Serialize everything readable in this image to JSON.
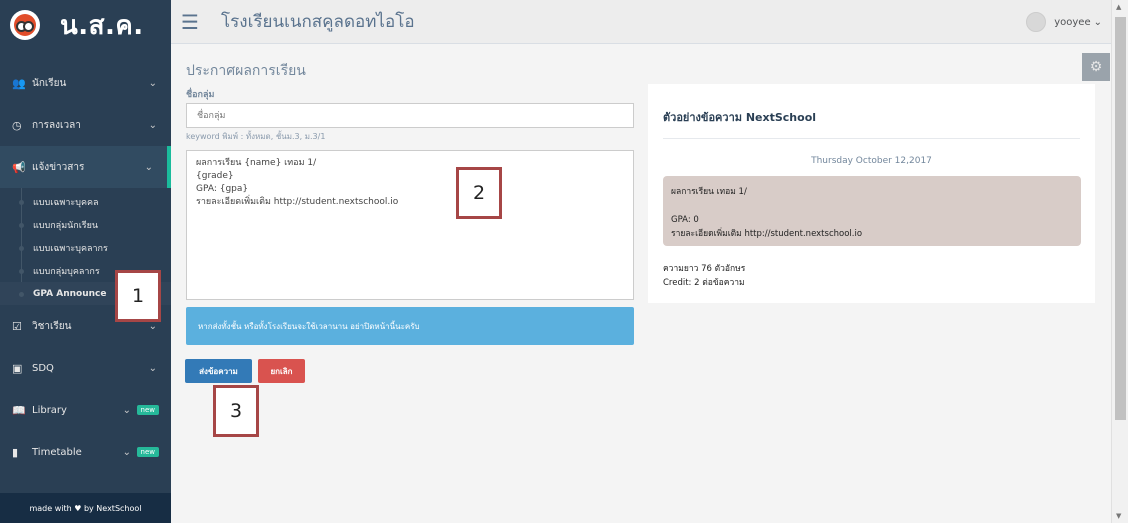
{
  "brand": {
    "title": "น.ส.ค."
  },
  "sidebar": {
    "items": [
      {
        "label": "นักเรียน",
        "icon": "users-icon"
      },
      {
        "label": "การลงเวลา",
        "icon": "clock-icon"
      },
      {
        "label": "แจ้งข่าวสาร",
        "icon": "bullhorn-icon"
      },
      {
        "label": "วิชาเรียน",
        "icon": "calendar-check-icon"
      },
      {
        "label": "SDQ",
        "icon": "id-card-icon"
      },
      {
        "label": "Library",
        "icon": "book-icon",
        "badge": "new"
      },
      {
        "label": "Timetable",
        "icon": "tablet-icon",
        "badge": "new"
      }
    ],
    "submenu": [
      "แบบเฉพาะบุคคล",
      "แบบกลุ่มนักเรียน",
      "แบบเฉพาะบุคลากร",
      "แบบกลุ่มบุคลากร",
      "GPA Announce"
    ],
    "footer": "made with ♥ by NextSchool"
  },
  "topnav": {
    "school_name": "โรงเรียนเนกสคูลดอทไอโอ",
    "user": "yooyee"
  },
  "form": {
    "page_title": "ประกาศผลการเรียน",
    "group_label": "ชื่อกลุ่ม",
    "group_placeholder": "ชื่อกลุ่ม",
    "hint": "keyword พิมพ์ : ทั้งหมด, ชั้นม.3, ม.3/1",
    "message": "ผลการเรียน {name} เทอม 1/\n{grade}\nGPA: {gpa}\nรายละเอียดเพิ่มเติม http://student.nextschool.io",
    "notice": "หากส่งทั้งชั้น หรือทั้งโรงเรียนจะใช้เวลานาน อย่าปิดหน้านี้นะครับ",
    "send_label": "ส่งข้อความ",
    "cancel_label": "ยกเลิก"
  },
  "preview": {
    "title": "ตัวอย่างข้อความ NextSchool",
    "date": "Thursday October 12,2017",
    "bubble": "ผลการเรียน เทอม 1/\n\nGPA: 0\nรายละเอียดเพิ่มเติม http://student.nextschool.io",
    "length": "ความยาว 76 ตัวอักษร",
    "credit": "Credit: 2 ต่อข้อความ"
  },
  "annotations": [
    "1",
    "2",
    "3"
  ]
}
